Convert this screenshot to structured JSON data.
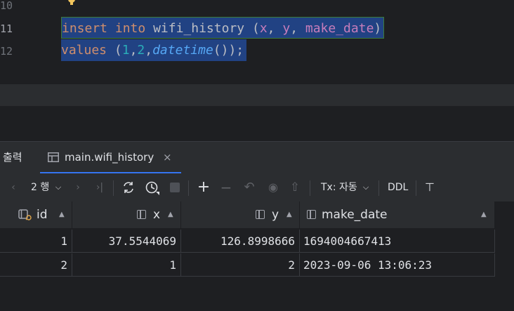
{
  "editor": {
    "lines": [
      {
        "number": "10"
      },
      {
        "number": "11"
      },
      {
        "number": "12"
      }
    ],
    "code": {
      "line11": {
        "insert": "insert",
        "into": "into",
        "table": "wifi_history",
        "open": "(",
        "x": "x",
        "comma1": ", ",
        "y": "y",
        "comma2": ", ",
        "make_date": "make_date",
        "close": ")"
      },
      "line12": {
        "values": "values",
        "open": "(",
        "one": "1",
        "c1": ",",
        "two": "2",
        "c2": ",",
        "func": "datetime",
        "tail": "());"
      }
    }
  },
  "panel": {
    "tabs": [
      {
        "label": "출력"
      },
      {
        "label": "main.wifi_history",
        "close": "×"
      }
    ]
  },
  "toolbar": {
    "row_count": "2 행",
    "tx_mode": "Tx: 자동",
    "ddl": "DDL",
    "icons": [
      "arrow-left-icon",
      "chevron-down-icon",
      "arrow-right-icon",
      "last-page-icon",
      "refresh-icon",
      "history-icon",
      "stop-icon",
      "add-row-icon",
      "remove-row-icon",
      "revert-icon",
      "preview-icon",
      "submit-icon",
      "chevron-down-icon",
      "pin-icon"
    ]
  },
  "table": {
    "columns": [
      {
        "name": "id",
        "icon": "key-column-icon"
      },
      {
        "name": "x",
        "icon": "column-icon"
      },
      {
        "name": "y",
        "icon": "column-icon"
      },
      {
        "name": "make_date",
        "icon": "column-icon"
      }
    ],
    "rows": [
      {
        "num": "1",
        "id": "1",
        "x": "37.5544069",
        "y": "126.8998666",
        "make_date": "1694004667413"
      },
      {
        "num": "2",
        "id": "2",
        "x": "1",
        "y": "2",
        "make_date": "2023-09-06 13:06:23"
      }
    ]
  },
  "colors": {
    "selection": "#214283",
    "keyword": "#cf8e6d",
    "column_ref": "#c77dbb",
    "number": "#2aacb8",
    "function": "#56a8f5",
    "active_tab_underline": "#3574f0"
  }
}
